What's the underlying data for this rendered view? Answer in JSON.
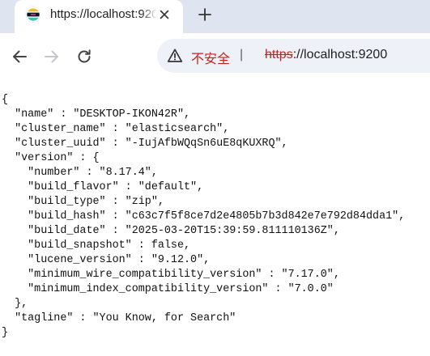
{
  "tab": {
    "title": "https://localhost:9200",
    "favicon": "elasticsearch-logo"
  },
  "omnibox": {
    "security_label": "不安全",
    "separator": "|",
    "scheme": "https",
    "url_rest": "://localhost:9200"
  },
  "icons": {
    "back": "back-arrow-icon",
    "forward": "forward-arrow-icon",
    "reload": "reload-icon",
    "close": "close-icon",
    "new_tab": "plus-icon",
    "warning": "warning-triangle-icon"
  },
  "json_lines": [
    "{",
    "  \"name\" : \"DESKTOP-IKON42R\",",
    "  \"cluster_name\" : \"elasticsearch\",",
    "  \"cluster_uuid\" : \"-IujAfbWQqSn6uE8qKUXRQ\",",
    "  \"version\" : {",
    "    \"number\" : \"8.17.4\",",
    "    \"build_flavor\" : \"default\",",
    "    \"build_type\" : \"zip\",",
    "    \"build_hash\" : \"c63c7f5f8ce7d2e4805b7b3d842e7e792d84dda1\",",
    "    \"build_date\" : \"2025-03-20T15:39:59.811110136Z\",",
    "    \"build_snapshot\" : false,",
    "    \"lucene_version\" : \"9.12.0\",",
    "    \"minimum_wire_compatibility_version\" : \"7.17.0\",",
    "    \"minimum_index_compatibility_version\" : \"7.0.0\"",
    "  },",
    "  \"tagline\" : \"You Know, for Search\"",
    "}"
  ]
}
